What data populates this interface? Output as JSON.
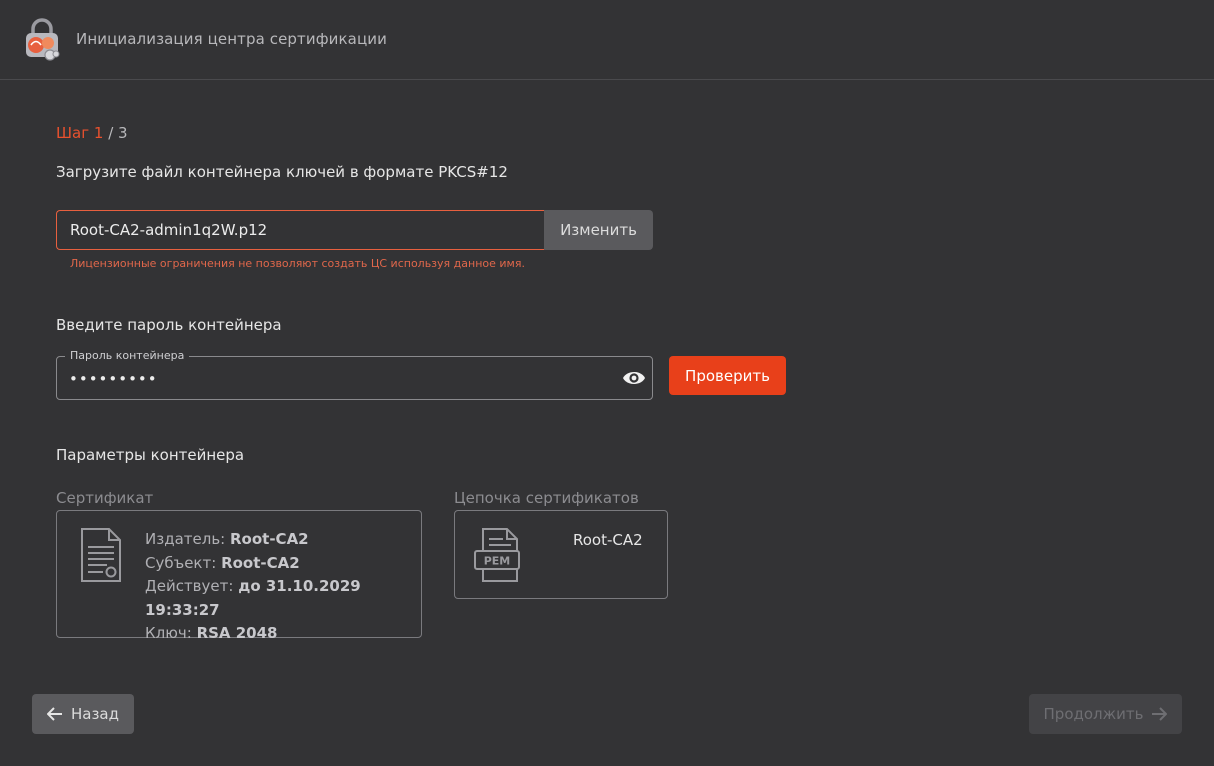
{
  "header": {
    "title": "Инициализация центра сертификации",
    "logo_icon": "lock-shield-logo-icon"
  },
  "step": {
    "current_label": "Шаг 1",
    "total_label": "/ 3"
  },
  "upload": {
    "heading": "Загрузите файл контейнера ключей в формате PKCS#12",
    "file_value": "Root-CA2-admin1q2W.p12",
    "change_label": "Изменить",
    "error": "Лицензионные ограничения не позволяют создать ЦС используя данное имя."
  },
  "password": {
    "heading": "Введите пароль контейнера",
    "field_label": "Пароль контейнера",
    "masked_value": "•••••••••",
    "toggle_icon": "eye-icon",
    "check_label": "Проверить"
  },
  "params": {
    "heading": "Параметры контейнера",
    "certificate": {
      "label": "Сертификат",
      "issuer_key": "Издатель:",
      "issuer_value": "Root-CA2",
      "subject_key": "Субъект:",
      "subject_value": "Root-CA2",
      "valid_key": "Действует:",
      "valid_value": "до 31.10.2029 19:33:27",
      "key_key": "Ключ:",
      "key_value": "RSA 2048"
    },
    "chain": {
      "label": "Цепочка сертификатов",
      "icon_text": "PEM",
      "item": "Root-CA2"
    }
  },
  "footer": {
    "back_label": "Назад",
    "continue_label": "Продолжить"
  },
  "colors": {
    "accent": "#e8401a",
    "error": "#e0674b",
    "background": "#333335"
  }
}
